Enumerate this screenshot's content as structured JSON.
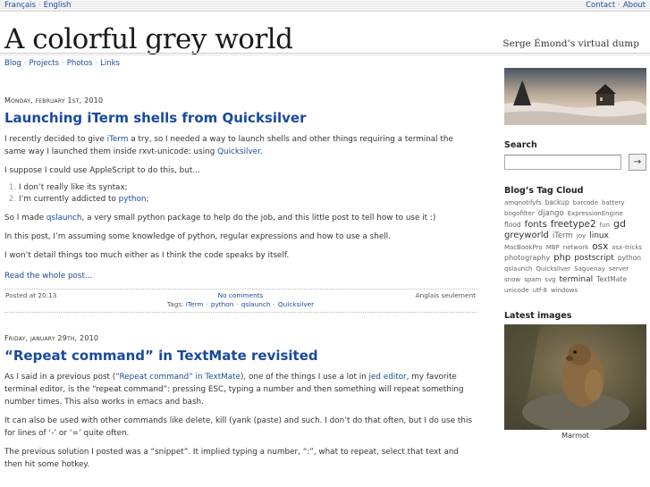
{
  "topbar": {
    "lang_fr": "Français",
    "lang_en": "English",
    "contact": "Contact",
    "about": "About",
    "sep": "·"
  },
  "header": {
    "site_title": "A colorful grey world",
    "tagline": "Serge Émond’s virtual dump"
  },
  "nav": {
    "items": [
      "Blog",
      "Projects",
      "Photos",
      "Links"
    ]
  },
  "post1": {
    "date": "Monday, february 1st, 2010",
    "title": "Launching iTerm shells from Quicksilver",
    "p1_a": "I recently decided to give ",
    "p1_link1": "iTerm",
    "p1_b": " a try, so I needed a way to launch shells and other things requiring a terminal the same way I launched them inside rxvt-unicode: using ",
    "p1_link2": "Quicksilver",
    "p1_c": ".",
    "p2": "I suppose I could use AppleScript to do this, but…",
    "li1": "I don’t really like its syntax;",
    "li2_a": "I’m currently addicted to ",
    "li2_link": "python",
    "li2_b": ";",
    "p3_a": "So I made ",
    "p3_link": "qslaunch",
    "p3_b": ", a very small python package to help do the job, and this little post to tell how to use it :)",
    "p4": "In this post, I’m assuming some knowledge of python, regular expressions and how to use a shell.",
    "p5": "I won’t detail things too much either as I think the code speaks by itself.",
    "read_more": "Read the whole post…",
    "posted": "Posted at 20:13",
    "comments": "No comments",
    "lang_note": "Anglais seulement",
    "tags_label": "Tags: ",
    "tags": [
      "iTerm",
      "python",
      "qslaunch",
      "Quicksilver"
    ]
  },
  "post2": {
    "date": "Friday, january 29th, 2010",
    "title": "“Repeat command” in TextMate revisited",
    "p1_a": "As I said in a previous post (",
    "p1_link1": "“Repeat command” in TextMate",
    "p1_b": "), one of the things I use a lot in ",
    "p1_link2": "jed editor",
    "p1_c": ", my favorite terminal editor, is the “repeat command”: pressing ESC, typing a number and then something will repeat something number times. This also works in emacs and bash.",
    "p2": "It can also be used with other commands like delete, kill (yank (paste) and such. I don’t do that often, but I do use this for lines of ‘-’ or ‘=’ quite often.",
    "p3": "The previous solution I posted was a “snippet”. It implied typing a number, “:”, what to repeat, select that text and then hit some hotkey."
  },
  "sidebar": {
    "search_heading": "Search",
    "search_button": "→",
    "cloud_heading": "Blog’s Tag Cloud",
    "cloud": [
      {
        "t": "amqnotifyfs",
        "s": 7
      },
      {
        "t": "backup",
        "s": 7.5
      },
      {
        "t": "barcode",
        "s": 7
      },
      {
        "t": "battery",
        "s": 7
      },
      {
        "t": "bogofilter",
        "s": 7
      },
      {
        "t": "django",
        "s": 8.5
      },
      {
        "t": "ExpressionEngine",
        "s": 7
      },
      {
        "t": "flood",
        "s": 7.5
      },
      {
        "t": "fonts",
        "s": 10
      },
      {
        "t": "freetype2",
        "s": 10.5
      },
      {
        "t": "fun",
        "s": 7
      },
      {
        "t": "gd",
        "s": 11
      },
      {
        "t": "greyworld",
        "s": 10
      },
      {
        "t": "iTerm",
        "s": 8.5
      },
      {
        "t": "joy",
        "s": 7
      },
      {
        "t": "linux",
        "s": 9
      },
      {
        "t": "MacBookPro",
        "s": 7
      },
      {
        "t": "MBP",
        "s": 7
      },
      {
        "t": "network",
        "s": 7
      },
      {
        "t": "osx",
        "s": 10.5
      },
      {
        "t": "osx-tricks",
        "s": 7
      },
      {
        "t": "photography",
        "s": 8
      },
      {
        "t": "php",
        "s": 10
      },
      {
        "t": "postscript",
        "s": 9
      },
      {
        "t": "python",
        "s": 7.5
      },
      {
        "t": "qslaunch",
        "s": 7
      },
      {
        "t": "Quicksilver",
        "s": 7
      },
      {
        "t": "Saguenay",
        "s": 7
      },
      {
        "t": "server",
        "s": 7
      },
      {
        "t": "snow",
        "s": 7
      },
      {
        "t": "spam",
        "s": 7
      },
      {
        "t": "svg",
        "s": 7
      },
      {
        "t": "terminal",
        "s": 9
      },
      {
        "t": "TextMate",
        "s": 7.5
      },
      {
        "t": "unicode",
        "s": 7
      },
      {
        "t": "utf-8",
        "s": 7
      },
      {
        "t": "windows",
        "s": 7
      }
    ],
    "images_heading": "Latest images",
    "image_caption": "Marmot"
  }
}
